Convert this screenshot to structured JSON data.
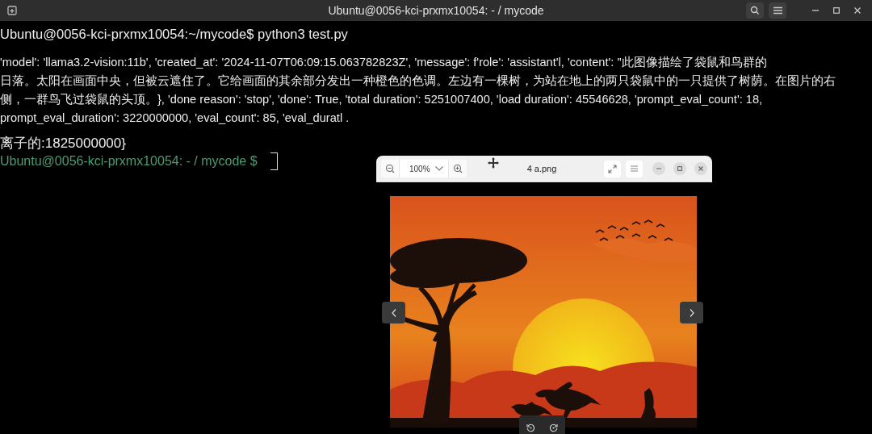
{
  "terminal": {
    "title": "Ubuntu@0056-kci-prxmx10054: - / mycode",
    "command_line": "Ubuntu@0056-kci-prxmx10054:~/mycode$ python3 test.py",
    "output_lines": [
      "'model': 'llama3.2-vision:11b', 'created_at': '2024-11-07T06:09:15.063782823Z', 'message': f'role': 'assistant'l, 'content': \"此图像描绘了袋鼠和鸟群的",
      "日落。太阳在画面中央，但被云遮住了。它给画面的其余部分发出一种橙色的色调。左边有一棵树，为站在地上的两只袋鼠中的一只提供了树荫。在图片的右",
      "侧，一群鸟飞过袋鼠的头顶。}, 'done reason': 'stop', 'done': True, 'total duration': 5251007400, 'load duration': 45546628, 'prompt_eval_count': 18,",
      "prompt_eval_duration': 3220000000, 'eval_count': 85, 'eval_duratl ."
    ],
    "result_line": "离子的:1825000000}",
    "prompt": "Ubuntu@0056-kci-prxmx10054: - / mycode $"
  },
  "image_viewer": {
    "zoom": "100%",
    "title": "4 a.png"
  }
}
